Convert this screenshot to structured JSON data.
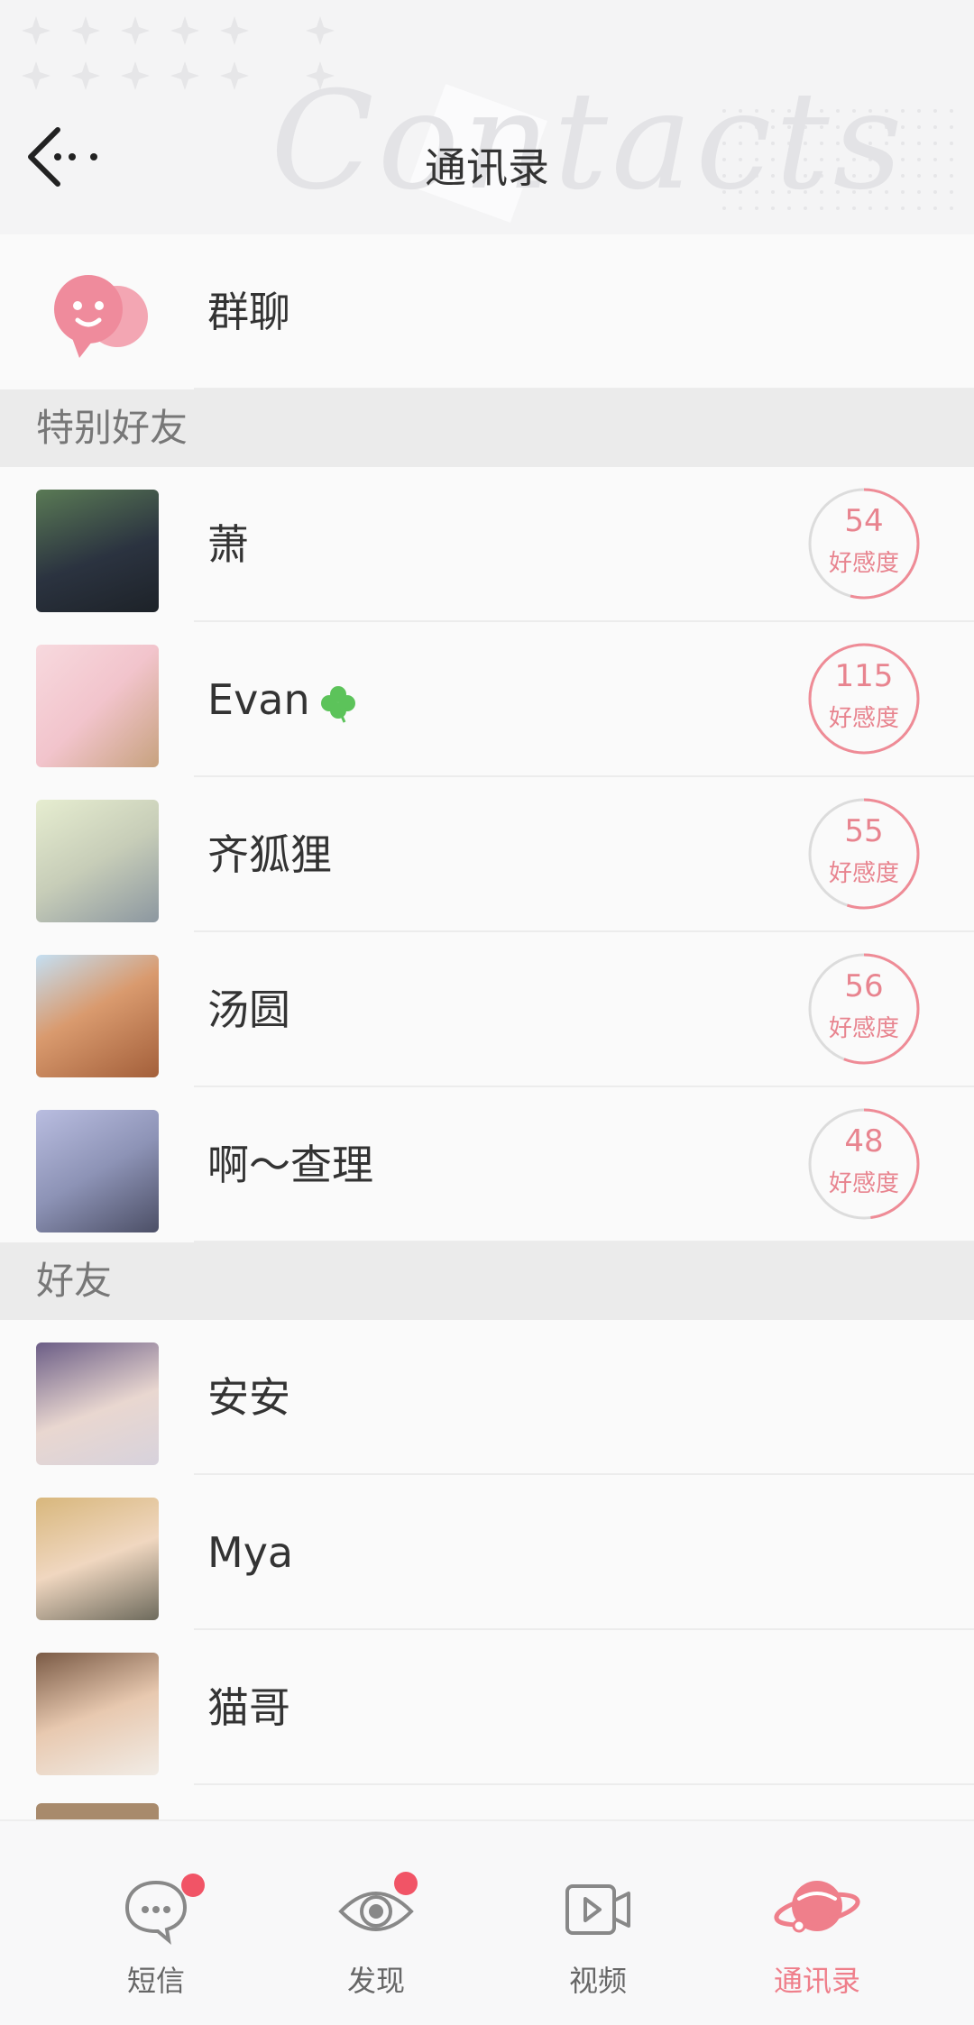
{
  "header": {
    "title": "通讯录",
    "watermark": "Contacts"
  },
  "group_chat": {
    "label": "群聊"
  },
  "sections": {
    "special": "特别好友",
    "friends": "好友"
  },
  "special_friends": [
    {
      "name": "萧",
      "affinity": "54",
      "affinity_label": "好感度",
      "avatar_color": "#3a4a55",
      "progress": 0.54
    },
    {
      "name": "Evan",
      "affinity": "115",
      "affinity_label": "好感度",
      "avatar_color": "#f2c9cf",
      "progress": 1.0
    },
    {
      "name": "齐狐狸",
      "affinity": "55",
      "affinity_label": "好感度",
      "avatar_color": "#c9d3b4",
      "progress": 0.55
    },
    {
      "name": "汤圆",
      "affinity": "56",
      "affinity_label": "好感度",
      "avatar_color": "#b7d1e6",
      "progress": 0.56
    },
    {
      "name": "啊～查理",
      "affinity": "48",
      "affinity_label": "好感度",
      "avatar_color": "#9aa0bf",
      "progress": 0.48
    }
  ],
  "friends": [
    {
      "name": "安安",
      "avatar_color": "#5b4c6e"
    },
    {
      "name": "Mya",
      "avatar_color": "#cdb183"
    },
    {
      "name": "猫哥",
      "avatar_color": "#9a7a62"
    }
  ],
  "nav": {
    "items": [
      {
        "label": "短信",
        "icon": "chat-bubble-icon",
        "badge": true,
        "active": false
      },
      {
        "label": "发现",
        "icon": "eye-icon",
        "badge": true,
        "active": false
      },
      {
        "label": "视频",
        "icon": "video-icon",
        "badge": false,
        "active": false
      },
      {
        "label": "通讯录",
        "icon": "planet-icon",
        "badge": false,
        "active": true
      }
    ]
  },
  "colors": {
    "accent": "#ef7f8b",
    "badge": "#f15466",
    "section_bg": "#ebebeb"
  }
}
